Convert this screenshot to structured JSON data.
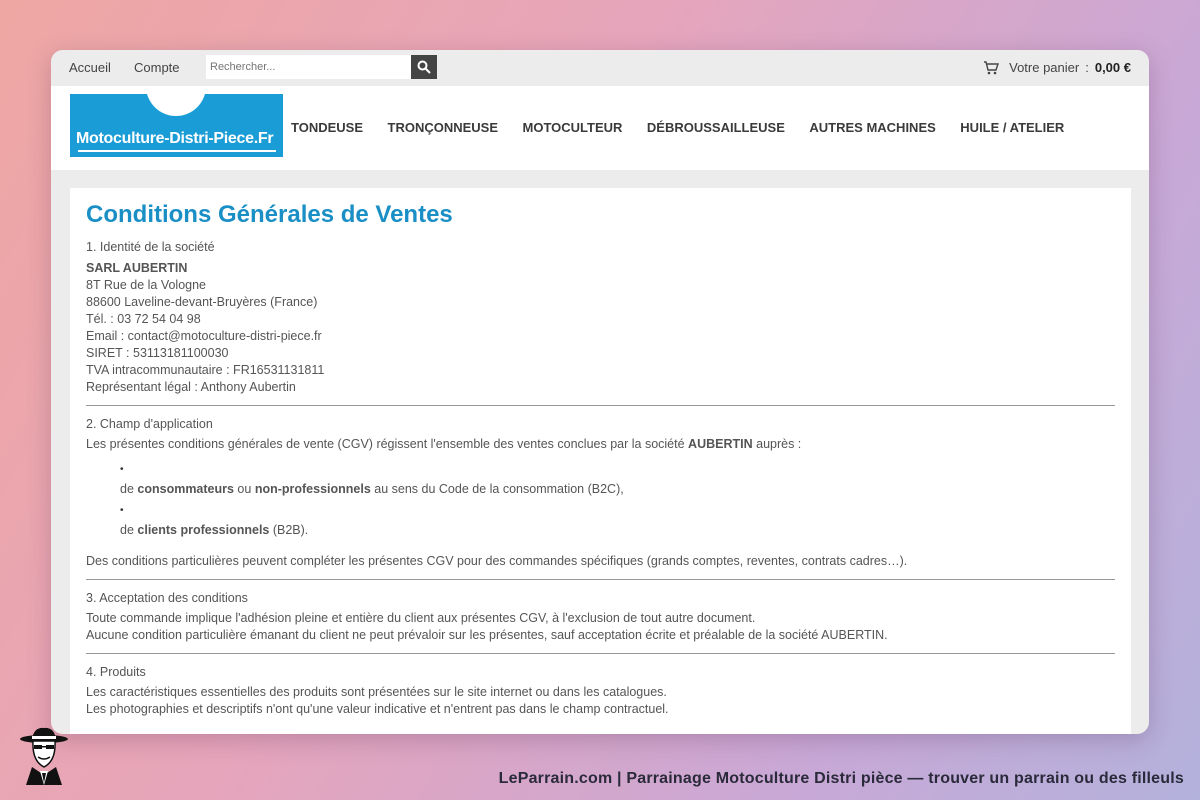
{
  "topbar": {
    "links": [
      "Accueil",
      "Compte"
    ],
    "search_placeholder": "Rechercher...",
    "cart_label": "Votre panier",
    "cart_sep": ":",
    "cart_amount": "0,00 €"
  },
  "logo": {
    "text": "Motoculture-Distri-Piece.Fr"
  },
  "nav": [
    "TONDEUSE",
    "TRONÇONNEUSE",
    "MOTOCULTEUR",
    "DÉBROUSSAILLEUSE",
    "AUTRES MACHINES",
    "HUILE / ATELIER"
  ],
  "page": {
    "title": "Conditions Générales de Ventes",
    "s1": {
      "title": "1. Identité de la société",
      "company": "SARL AUBERTIN",
      "lines": [
        "8T Rue de la Vologne",
        "88600 Laveline-devant-Bruyères (France)",
        "Tél. : 03 72 54 04 98",
        "Email : contact@motoculture-distri-piece.fr",
        "SIRET : 53113181100030",
        "TVA intracommunautaire : FR16531131811",
        "Représentant légal : Anthony Aubertin"
      ]
    },
    "s2": {
      "title": "2. Champ d'application",
      "intro": "Les présentes conditions générales de vente (CGV) régissent l'ensemble des ventes conclues par la société",
      "intro_bold": "AUBERTIN",
      "intro_end": " auprès :",
      "bullet": "•",
      "b1": {
        "pre": "de ",
        "bold1": "consommateurs",
        "mid": " ou ",
        "bold2": "non-professionnels",
        "post": " au sens du Code de la consommation (B2C),"
      },
      "b2": {
        "pre": "de ",
        "bold1": "clients professionnels",
        "post": " (B2B)."
      },
      "outro": "Des conditions particulières peuvent compléter les présentes CGV pour des commandes spécifiques (grands comptes, reventes, contrats cadres…)."
    },
    "s3": {
      "title": "3. Acceptation des conditions",
      "lines": [
        "Toute commande implique l'adhésion pleine et entière du client aux présentes CGV, à l'exclusion de tout autre document.",
        "Aucune condition particulière émanant du client ne peut prévaloir sur les présentes, sauf acceptation écrite et préalable de la société AUBERTIN."
      ]
    },
    "s4": {
      "title": "4. Produits",
      "lines": [
        "Les caractéristiques essentielles des produits sont présentées sur le site internet ou dans les catalogues.",
        "Les photographies et descriptifs n'ont qu'une valeur indicative et n'entrent pas dans le champ contractuel."
      ]
    }
  },
  "footer": {
    "caption": "LeParrain.com | Parrainage Motoculture Distri pièce — trouver un parrain ou des filleuls"
  }
}
